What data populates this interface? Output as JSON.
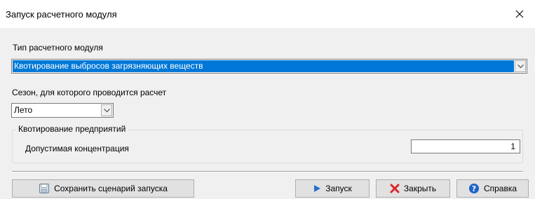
{
  "window": {
    "title": "Запуск расчетного модуля",
    "close_glyph": "✕"
  },
  "module_type": {
    "label": "Тип расчетного модуля",
    "selected": "Квотирование выбросов загрязняющих веществ"
  },
  "season": {
    "label": "Сезон, для которого проводится расчет",
    "selected": "Лето"
  },
  "quota_group": {
    "legend": "Квотирование предприятий",
    "field_label": "Допустимая концентрация",
    "field_value": "1"
  },
  "buttons": {
    "save_scenario": "Сохранить сценарий запуска",
    "run": "Запуск",
    "close": "Закрыть",
    "help": "Справка"
  },
  "icons": {
    "save": "floppy-disk-icon",
    "run": "play-triangle-icon",
    "close": "red-x-icon",
    "help": "help-question-icon",
    "dropdown": "chevron-down-icon"
  },
  "colors": {
    "selection": "#0078d7",
    "run_icon": "#2a6fc9",
    "close_icon": "#d9262c",
    "help_icon": "#1c64c8",
    "client_bg": "#f0f0f0"
  }
}
